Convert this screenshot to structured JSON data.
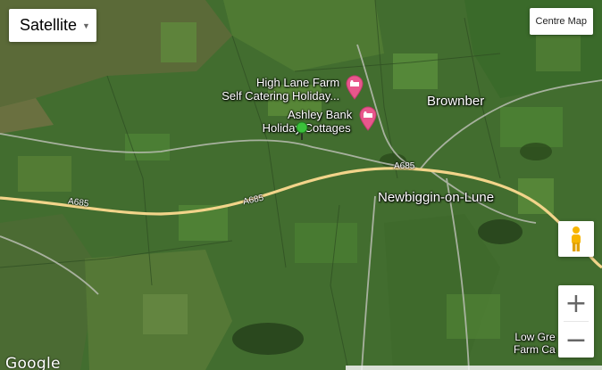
{
  "map": {
    "map_type_label": "Satellite",
    "centre_button_label": "Centre Map",
    "logo_text": "Google",
    "poi": [
      {
        "line1": "High Lane Farm",
        "line2": "Self Catering Holiday..."
      },
      {
        "line1": "Ashley Bank",
        "line2": "Holiday Cottages"
      }
    ],
    "places": {
      "brownber": "Brownber",
      "newbiggin": "Newbiggin-on-Lune",
      "lowgre_1": "Low Gre",
      "lowgre_2": "Farm Ca"
    },
    "roads": [
      "A685",
      "A685",
      "A685"
    ],
    "zoom_in_label": "+",
    "zoom_out_label": "−",
    "colors": {
      "poi_pin": "#e8578c",
      "marker": "#3bc13b",
      "road": "#f2d48a"
    },
    "icons": [
      "lodging-pin-icon",
      "location-marker-icon",
      "pegman-icon",
      "chevron-down-icon"
    ]
  }
}
